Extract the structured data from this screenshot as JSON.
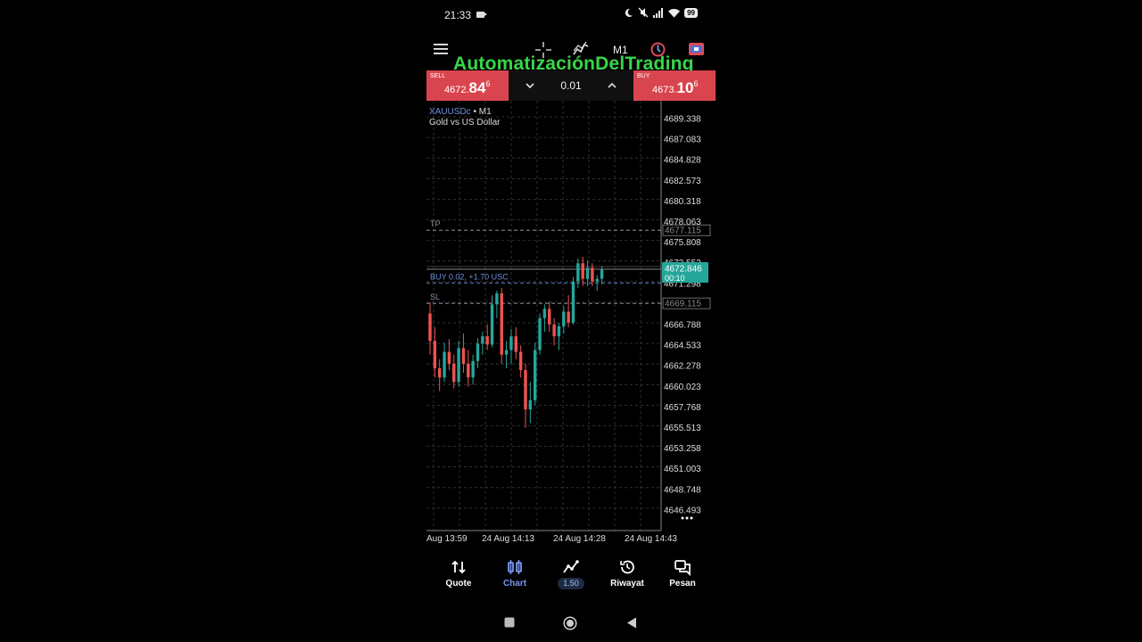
{
  "status": {
    "time": "21:33",
    "battery": "99"
  },
  "toolbar": {
    "timeframe": "M1"
  },
  "watermark": "AutomatizaciónDelTrading",
  "trade": {
    "sell_label": "SELL",
    "sell_prefix": "4672.",
    "sell_big": "84",
    "sell_sup": "6",
    "buy_label": "BUY",
    "buy_prefix": "4673.",
    "buy_big": "10",
    "buy_sup": "6",
    "lot": "0.01"
  },
  "chart": {
    "symbol": "XAUUSDc",
    "timeframe": "• M1",
    "description": "Gold vs US Dollar",
    "price_labels": [
      "4689.338",
      "4687.083",
      "4684.828",
      "4682.573",
      "4680.318",
      "4678.063",
      "4675.808",
      "4673.553",
      "4671.298",
      "4666.788",
      "4664.533",
      "4662.278",
      "4660.023",
      "4657.768",
      "4655.513",
      "4653.258",
      "4651.003",
      "4648.748",
      "4646.493"
    ],
    "time_labels": [
      "Aug 13:59",
      "24 Aug 14:13",
      "24 Aug 14:28",
      "24 Aug 14:43"
    ],
    "tp_label": "TP",
    "tp_price": "4677.115",
    "sl_label": "SL",
    "sl_price": "4669.115",
    "position_label": "BUY 0.02, +1.70 USC",
    "current_price": "4672.846",
    "countdown": "00:10",
    "colors": {
      "bull": "#26a69a",
      "bear": "#ef5350",
      "grid": "#3a3a3a",
      "accent": "#26a69a"
    },
    "candles": [
      [
        4668.0,
        4669.2,
        4663.5,
        4665.0
      ],
      [
        4665.0,
        4666.5,
        4661.0,
        4662.0
      ],
      [
        4662.0,
        4663.0,
        4659.5,
        4661.0
      ],
      [
        4661.0,
        4664.8,
        4660.5,
        4663.8
      ],
      [
        4663.8,
        4665.2,
        4661.8,
        4662.5
      ],
      [
        4662.5,
        4663.5,
        4659.8,
        4660.5
      ],
      [
        4660.5,
        4665.0,
        4660.0,
        4664.2
      ],
      [
        4664.2,
        4665.8,
        4661.5,
        4662.5
      ],
      [
        4662.5,
        4664.0,
        4660.0,
        4661.0
      ],
      [
        4661.0,
        4663.5,
        4660.2,
        4662.8
      ],
      [
        4662.8,
        4665.3,
        4662.0,
        4664.7
      ],
      [
        4664.7,
        4666.0,
        4663.5,
        4665.5
      ],
      [
        4665.5,
        4666.8,
        4664.0,
        4664.6
      ],
      [
        4664.6,
        4670.0,
        4664.3,
        4669.0
      ],
      [
        4669.0,
        4670.5,
        4667.5,
        4670.2
      ],
      [
        4670.2,
        4670.8,
        4662.5,
        4663.5
      ],
      [
        4663.5,
        4665.0,
        4662.0,
        4664.0
      ],
      [
        4664.0,
        4666.3,
        4662.5,
        4665.5
      ],
      [
        4665.5,
        4666.5,
        4663.0,
        4663.8
      ],
      [
        4663.8,
        4664.5,
        4661.0,
        4661.8
      ],
      [
        4661.8,
        4662.5,
        4655.5,
        4657.5
      ],
      [
        4657.5,
        4660.5,
        4656.0,
        4658.5
      ],
      [
        4658.5,
        4664.8,
        4658.0,
        4664.0
      ],
      [
        4664.0,
        4668.0,
        4663.5,
        4667.5
      ],
      [
        4667.5,
        4669.0,
        4666.0,
        4668.5
      ],
      [
        4668.5,
        4669.3,
        4666.0,
        4666.8
      ],
      [
        4666.8,
        4667.5,
        4664.5,
        4665.5
      ],
      [
        4665.5,
        4667.0,
        4664.0,
        4666.6
      ],
      [
        4666.6,
        4668.8,
        4665.8,
        4668.2
      ],
      [
        4668.2,
        4670.0,
        4666.5,
        4667.0
      ],
      [
        4667.0,
        4672.0,
        4666.8,
        4671.5
      ],
      [
        4671.5,
        4674.0,
        4670.8,
        4673.5
      ],
      [
        4673.5,
        4674.2,
        4671.0,
        4671.8
      ],
      [
        4671.8,
        4673.8,
        4671.0,
        4673.0
      ],
      [
        4673.0,
        4673.5,
        4671.0,
        4671.5
      ],
      [
        4671.5,
        4672.2,
        4670.5,
        4671.8
      ],
      [
        4671.8,
        4673.2,
        4671.2,
        4672.8
      ]
    ]
  },
  "nav": {
    "quote": "Quote",
    "chart": "Chart",
    "trade_badge": "1.50",
    "history": "Riwayat",
    "messages": "Pesan"
  }
}
